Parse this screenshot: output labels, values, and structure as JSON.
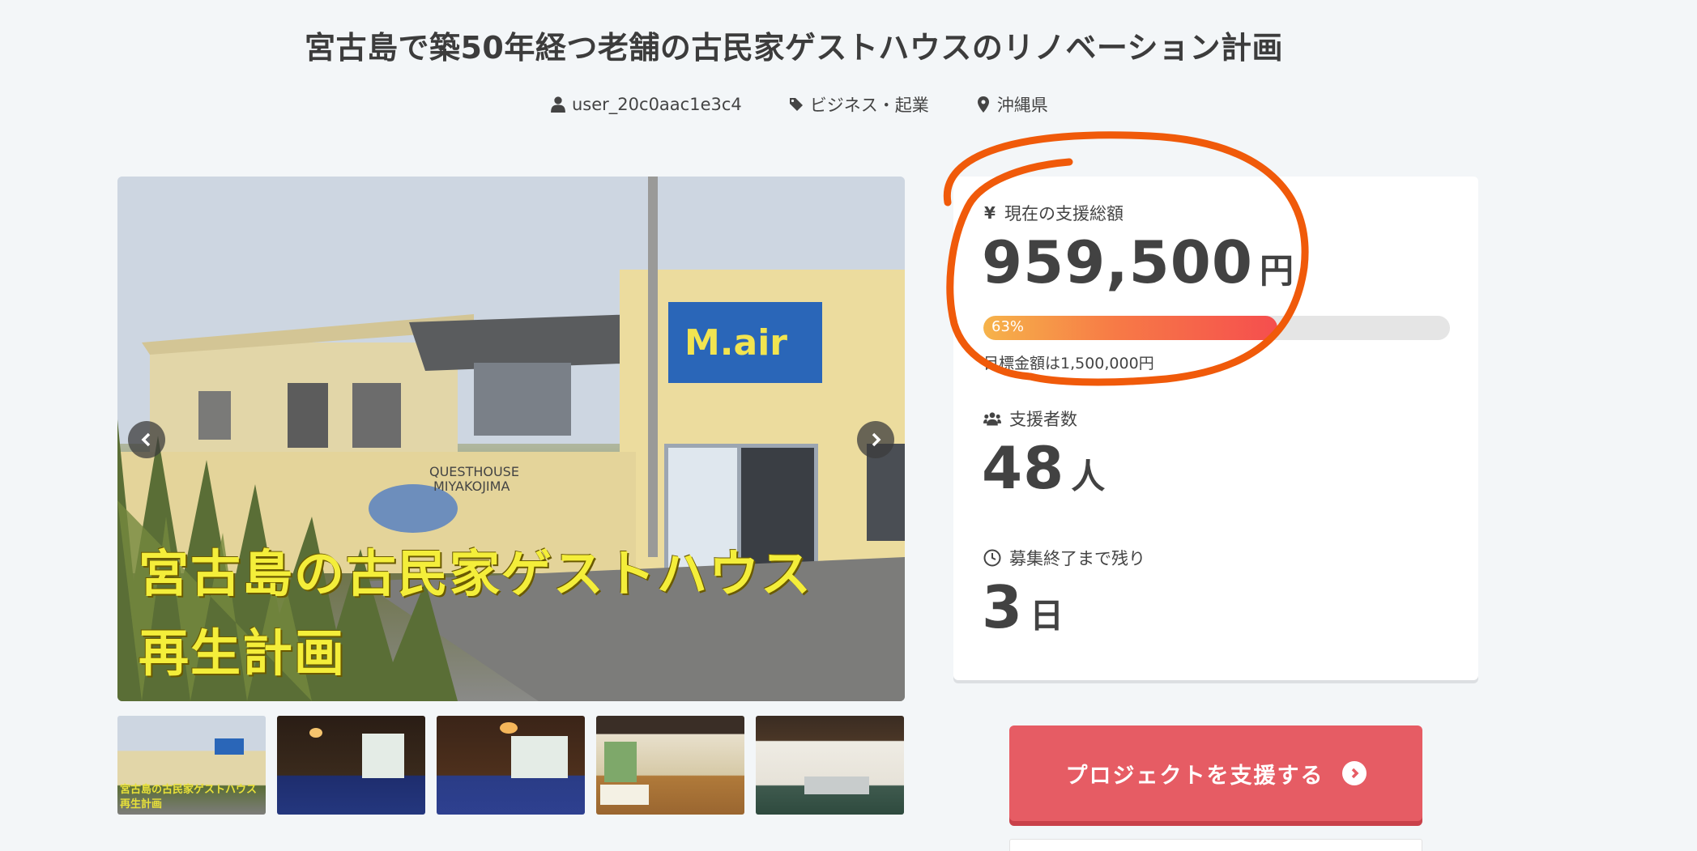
{
  "page": {
    "title": "宮古島で築50年経つ老舗の古民家ゲストハウスのリノベーション計画"
  },
  "meta": {
    "user": "user_20c0aac1e3c4",
    "category": "ビジネス・起業",
    "location": "沖縄県"
  },
  "hero": {
    "caption_line1": "宮古島の古民家ゲストハウス",
    "caption_line2": "再生計画",
    "sign_text": "GUESTHOUSE MIYAKOJIMA"
  },
  "thumbnails": [
    {
      "caption1": "宮古島の古民家ゲストハウス",
      "caption2": "再生計画"
    },
    {
      "caption1": "",
      "caption2": ""
    },
    {
      "caption1": "",
      "caption2": ""
    },
    {
      "caption1": "",
      "caption2": ""
    },
    {
      "caption1": "",
      "caption2": ""
    }
  ],
  "stats": {
    "amount_label": "現在の支援総額",
    "amount_value": "959,500",
    "amount_unit": "円",
    "progress_percent": 63,
    "progress_label": "63%",
    "goal_text": "目標金額は1,500,000円",
    "backers_label": "支援者数",
    "backers_value": "48",
    "backers_unit": "人",
    "remaining_label": "募集終了まで残り",
    "remaining_value": "3",
    "remaining_unit": "日"
  },
  "cta": {
    "support_label": "プロジェクトを支援する"
  },
  "colors": {
    "accent": "#e65c64",
    "annotation": "#f05a0a"
  }
}
